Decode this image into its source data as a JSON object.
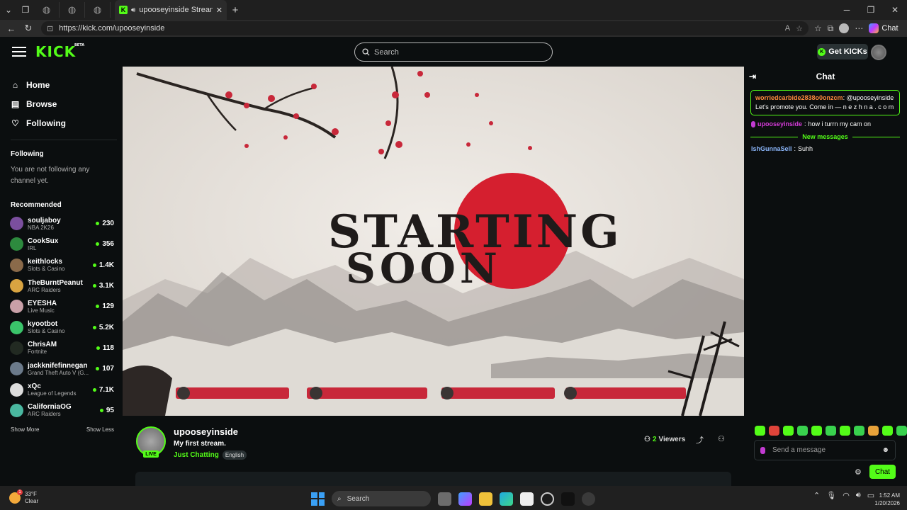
{
  "browser": {
    "tab_title": "upooseyinside Stream - Watch",
    "url": "https://kick.com/upooseyinside",
    "chat_label": "Chat"
  },
  "header": {
    "logo": "KICK",
    "logo_badge": "BETA",
    "search_placeholder": "Search",
    "get_kicks": "Get KICKs"
  },
  "sidebar": {
    "nav": [
      {
        "label": "Home",
        "icon": "home-icon"
      },
      {
        "label": "Browse",
        "icon": "browse-icon"
      },
      {
        "label": "Following",
        "icon": "heart-icon"
      }
    ],
    "following_heading": "Following",
    "following_empty": "You are not following any channel yet.",
    "recommended_heading": "Recommended",
    "recommended": [
      {
        "name": "souljaboy",
        "category": "NBA 2K26",
        "viewers": "230",
        "color": "#7b4f9e"
      },
      {
        "name": "CookSux",
        "category": "IRL",
        "viewers": "356",
        "color": "#2d8a3e"
      },
      {
        "name": "keithlocks",
        "category": "Slots & Casino",
        "viewers": "1.4K",
        "color": "#8a6a4a"
      },
      {
        "name": "TheBurntPeanut",
        "category": "ARC Raiders",
        "viewers": "3.1K",
        "color": "#d9a441"
      },
      {
        "name": "EYESHA",
        "category": "Live Music",
        "viewers": "129",
        "color": "#c9a0a8"
      },
      {
        "name": "kyootbot",
        "category": "Slots & Casino",
        "viewers": "5.2K",
        "color": "#3ac46a"
      },
      {
        "name": "ChrisAM",
        "category": "Fortnite",
        "viewers": "118",
        "color": "#222a22"
      },
      {
        "name": "jackknifefinnegan",
        "category": "Grand Theft Auto V (G...",
        "viewers": "107",
        "color": "#6b7a8a"
      },
      {
        "name": "xQc",
        "category": "League of Legends",
        "viewers": "7.1K",
        "color": "#dddddd"
      },
      {
        "name": "CaliforniaOG",
        "category": "ARC Raiders",
        "viewers": "95",
        "color": "#4ab8a0"
      }
    ],
    "show_more": "Show More",
    "show_less": "Show Less"
  },
  "stream": {
    "channel": "upooseyinside",
    "title": "My first stream.",
    "category": "Just Chatting",
    "language": "English",
    "live_badge": "LIVE",
    "viewers_count": "2",
    "viewers_label": "Viewers",
    "overlay_text_1": "STARTING",
    "overlay_text_2": "SOON"
  },
  "chat": {
    "title": "Chat",
    "pinned_user": "worriedcarbide2838o0onzcm",
    "pinned_text": "@upooseyinside Let's promote you. Come in — n e z h n a . c o m",
    "messages": [
      {
        "user": "upooseyinside",
        "text": "how i turrn my cam on"
      }
    ],
    "new_messages_label": "New messages",
    "new_messages": [
      {
        "user": "IshGunnaSell",
        "text": "Suhh"
      }
    ],
    "input_placeholder": "Send a message",
    "send_label": "Chat"
  },
  "taskbar": {
    "temperature": "33°F",
    "condition": "Clear",
    "search_label": "Search",
    "time": "1:52 AM",
    "date": "1/20/2026"
  }
}
